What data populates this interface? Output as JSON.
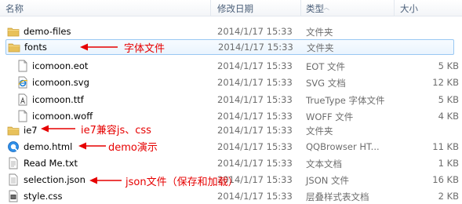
{
  "columns": {
    "name": "名称",
    "date": "修改日期",
    "type": "类型",
    "size": "大小"
  },
  "rows": [
    {
      "name": "demo-files",
      "date": "2014/1/17 15:33",
      "type": "文件夹",
      "size": "",
      "icon": "folder-icon"
    },
    {
      "name": "fonts",
      "date": "2014/1/17 15:33",
      "type": "文件夹",
      "size": "",
      "icon": "folder-icon",
      "selected": true
    },
    {
      "name": "icomoon.eot",
      "date": "2014/1/17 15:33",
      "type": "EOT 文件",
      "size": "5 KB",
      "icon": "file-icon"
    },
    {
      "name": "icomoon.svg",
      "date": "2014/1/17 15:33",
      "type": "SVG 文档",
      "size": "12 KB",
      "icon": "ie-document-icon"
    },
    {
      "name": "icomoon.ttf",
      "date": "2014/1/17 15:33",
      "type": "TrueType 字体文件",
      "size": "5 KB",
      "icon": "font-file-icon"
    },
    {
      "name": "icomoon.woff",
      "date": "2014/1/17 15:33",
      "type": "WOFF 文件",
      "size": "4 KB",
      "icon": "file-icon"
    },
    {
      "name": "ie7",
      "date": "2014/1/17 15:33",
      "type": "文件夹",
      "size": "",
      "icon": "folder-icon"
    },
    {
      "name": "demo.html",
      "date": "2014/1/17 15:33",
      "type": "QQBrowser HT...",
      "size": "11 KB",
      "icon": "browser-icon"
    },
    {
      "name": "Read Me.txt",
      "date": "2014/1/17 15:33",
      "type": "文本文档",
      "size": "1 KB",
      "icon": "text-file-icon"
    },
    {
      "name": "selection.json",
      "date": "2014/1/17 15:33",
      "type": "JSON 文件",
      "size": "16 KB",
      "icon": "json-file-icon"
    },
    {
      "name": "style.css",
      "date": "2014/1/17 15:33",
      "type": "层叠样式表文档",
      "size": "2 KB",
      "icon": "css-file-icon"
    }
  ],
  "annotations": {
    "fonts": "字体文件",
    "ie7": "ie7兼容js、css",
    "demo": "demo演示",
    "json": "json文件（保存和加载）"
  },
  "colors": {
    "annotation": "#e60000",
    "selection_border": "#99c8f3",
    "folder": "#e8c15a"
  }
}
